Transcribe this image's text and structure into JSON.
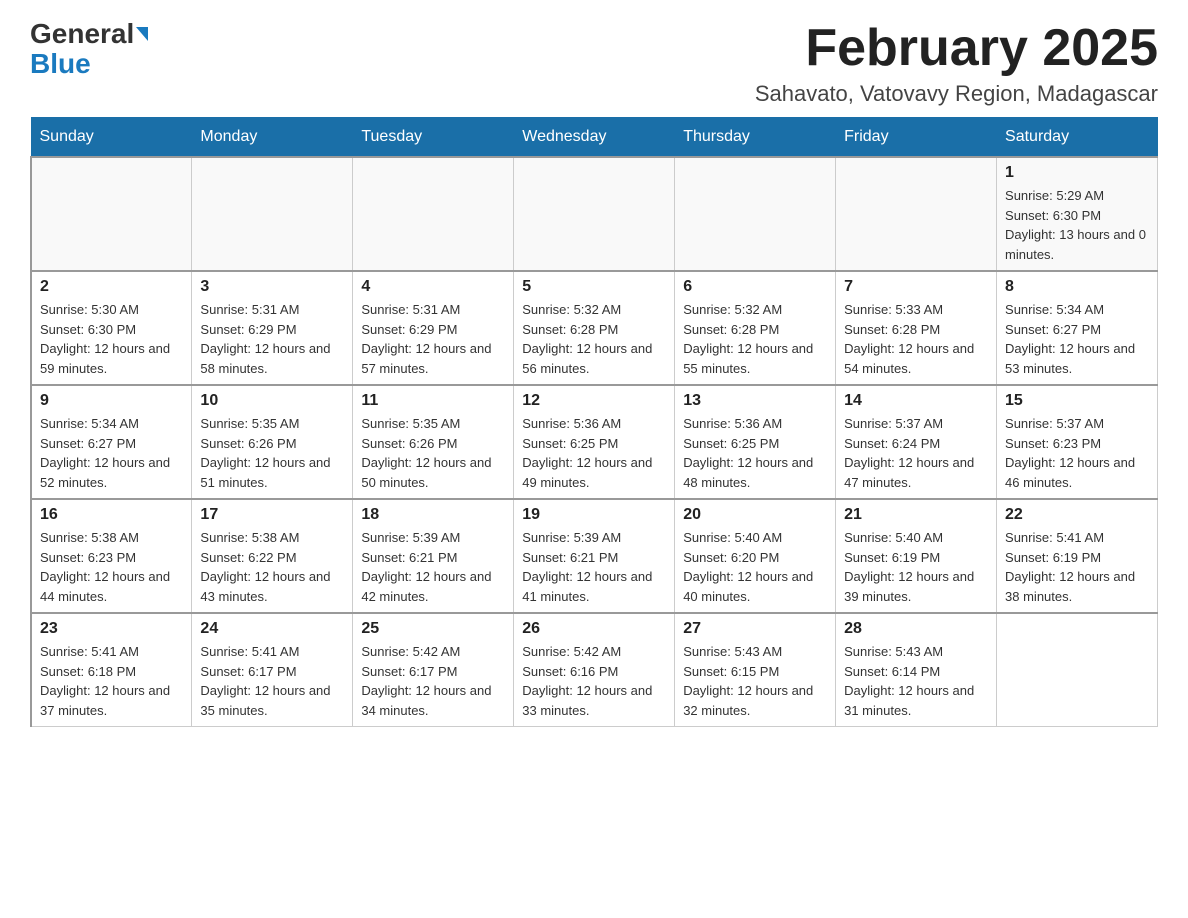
{
  "header": {
    "logo_line1": "General",
    "logo_line2": "Blue",
    "month_title": "February 2025",
    "location": "Sahavato, Vatovavy Region, Madagascar"
  },
  "days_of_week": [
    "Sunday",
    "Monday",
    "Tuesday",
    "Wednesday",
    "Thursday",
    "Friday",
    "Saturday"
  ],
  "weeks": [
    [
      {
        "day": "",
        "info": ""
      },
      {
        "day": "",
        "info": ""
      },
      {
        "day": "",
        "info": ""
      },
      {
        "day": "",
        "info": ""
      },
      {
        "day": "",
        "info": ""
      },
      {
        "day": "",
        "info": ""
      },
      {
        "day": "1",
        "info": "Sunrise: 5:29 AM\nSunset: 6:30 PM\nDaylight: 13 hours and 0 minutes."
      }
    ],
    [
      {
        "day": "2",
        "info": "Sunrise: 5:30 AM\nSunset: 6:30 PM\nDaylight: 12 hours and 59 minutes."
      },
      {
        "day": "3",
        "info": "Sunrise: 5:31 AM\nSunset: 6:29 PM\nDaylight: 12 hours and 58 minutes."
      },
      {
        "day": "4",
        "info": "Sunrise: 5:31 AM\nSunset: 6:29 PM\nDaylight: 12 hours and 57 minutes."
      },
      {
        "day": "5",
        "info": "Sunrise: 5:32 AM\nSunset: 6:28 PM\nDaylight: 12 hours and 56 minutes."
      },
      {
        "day": "6",
        "info": "Sunrise: 5:32 AM\nSunset: 6:28 PM\nDaylight: 12 hours and 55 minutes."
      },
      {
        "day": "7",
        "info": "Sunrise: 5:33 AM\nSunset: 6:28 PM\nDaylight: 12 hours and 54 minutes."
      },
      {
        "day": "8",
        "info": "Sunrise: 5:34 AM\nSunset: 6:27 PM\nDaylight: 12 hours and 53 minutes."
      }
    ],
    [
      {
        "day": "9",
        "info": "Sunrise: 5:34 AM\nSunset: 6:27 PM\nDaylight: 12 hours and 52 minutes."
      },
      {
        "day": "10",
        "info": "Sunrise: 5:35 AM\nSunset: 6:26 PM\nDaylight: 12 hours and 51 minutes."
      },
      {
        "day": "11",
        "info": "Sunrise: 5:35 AM\nSunset: 6:26 PM\nDaylight: 12 hours and 50 minutes."
      },
      {
        "day": "12",
        "info": "Sunrise: 5:36 AM\nSunset: 6:25 PM\nDaylight: 12 hours and 49 minutes."
      },
      {
        "day": "13",
        "info": "Sunrise: 5:36 AM\nSunset: 6:25 PM\nDaylight: 12 hours and 48 minutes."
      },
      {
        "day": "14",
        "info": "Sunrise: 5:37 AM\nSunset: 6:24 PM\nDaylight: 12 hours and 47 minutes."
      },
      {
        "day": "15",
        "info": "Sunrise: 5:37 AM\nSunset: 6:23 PM\nDaylight: 12 hours and 46 minutes."
      }
    ],
    [
      {
        "day": "16",
        "info": "Sunrise: 5:38 AM\nSunset: 6:23 PM\nDaylight: 12 hours and 44 minutes."
      },
      {
        "day": "17",
        "info": "Sunrise: 5:38 AM\nSunset: 6:22 PM\nDaylight: 12 hours and 43 minutes."
      },
      {
        "day": "18",
        "info": "Sunrise: 5:39 AM\nSunset: 6:21 PM\nDaylight: 12 hours and 42 minutes."
      },
      {
        "day": "19",
        "info": "Sunrise: 5:39 AM\nSunset: 6:21 PM\nDaylight: 12 hours and 41 minutes."
      },
      {
        "day": "20",
        "info": "Sunrise: 5:40 AM\nSunset: 6:20 PM\nDaylight: 12 hours and 40 minutes."
      },
      {
        "day": "21",
        "info": "Sunrise: 5:40 AM\nSunset: 6:19 PM\nDaylight: 12 hours and 39 minutes."
      },
      {
        "day": "22",
        "info": "Sunrise: 5:41 AM\nSunset: 6:19 PM\nDaylight: 12 hours and 38 minutes."
      }
    ],
    [
      {
        "day": "23",
        "info": "Sunrise: 5:41 AM\nSunset: 6:18 PM\nDaylight: 12 hours and 37 minutes."
      },
      {
        "day": "24",
        "info": "Sunrise: 5:41 AM\nSunset: 6:17 PM\nDaylight: 12 hours and 35 minutes."
      },
      {
        "day": "25",
        "info": "Sunrise: 5:42 AM\nSunset: 6:17 PM\nDaylight: 12 hours and 34 minutes."
      },
      {
        "day": "26",
        "info": "Sunrise: 5:42 AM\nSunset: 6:16 PM\nDaylight: 12 hours and 33 minutes."
      },
      {
        "day": "27",
        "info": "Sunrise: 5:43 AM\nSunset: 6:15 PM\nDaylight: 12 hours and 32 minutes."
      },
      {
        "day": "28",
        "info": "Sunrise: 5:43 AM\nSunset: 6:14 PM\nDaylight: 12 hours and 31 minutes."
      },
      {
        "day": "",
        "info": ""
      }
    ]
  ]
}
